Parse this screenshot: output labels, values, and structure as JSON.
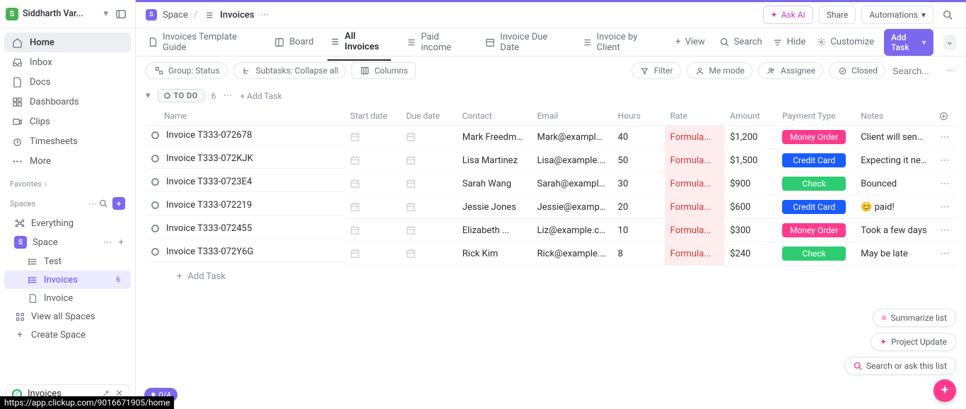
{
  "workspace": {
    "badge": "S",
    "name": "Siddharth Var..."
  },
  "nav": {
    "items": [
      {
        "label": "Home"
      },
      {
        "label": "Inbox"
      },
      {
        "label": "Docs"
      },
      {
        "label": "Dashboards"
      },
      {
        "label": "Clips"
      },
      {
        "label": "Timesheets"
      },
      {
        "label": "More"
      }
    ]
  },
  "favorites_label": "Favorites",
  "spaces_label": "Spaces",
  "spaces": {
    "everything": "Everything",
    "space_badge": "S",
    "space_name": "Space",
    "test": "Test",
    "invoices": "Invoices",
    "invoices_count": "6",
    "invoice_single": "Invoice",
    "view_all": "View all Spaces",
    "create": "Create Space"
  },
  "footer": {
    "label": "Invoices"
  },
  "breadcrumb": {
    "space": "Space",
    "list": "Invoices"
  },
  "topbar": {
    "ask_ai": "Ask AI",
    "share": "Share",
    "automations": "Automations"
  },
  "views": {
    "guide": "Invoices Template Guide",
    "board": "Board",
    "all": "All Invoices",
    "paid": "Paid income",
    "due": "Invoice Due Date",
    "by_client": "Invoice by Client",
    "view": "View",
    "search": "Search",
    "hide": "Hide",
    "customize": "Customize",
    "add_task": "Add Task"
  },
  "filters": {
    "group": "Group: Status",
    "subtasks": "Subtasks: Collapse all",
    "columns": "Columns",
    "filter": "Filter",
    "me": "Me mode",
    "assignee": "Assignee",
    "closed": "Closed",
    "search_ph": "Search..."
  },
  "group": {
    "status": "TO DO",
    "count": "6",
    "add": "Add Task"
  },
  "columns": {
    "name": "Name",
    "start": "Start date",
    "due": "Due date",
    "contact": "Contact",
    "email": "Email",
    "hours": "Hours",
    "rate": "Rate",
    "amount": "Amount",
    "payment": "Payment Type",
    "notes": "Notes"
  },
  "rate_text": "Formula...",
  "rows": [
    {
      "name": "Invoice T333-072678",
      "contact": "Mark Freedman",
      "email": "Mark@example.c...",
      "hours": "40",
      "amount": "$1,200",
      "pay": "Money Order",
      "pay_cls": "money",
      "notes": "Client will send ..."
    },
    {
      "name": "Invoice T333-072KJK",
      "contact": "Lisa Martinez",
      "email": "Lisa@example.com",
      "hours": "50",
      "amount": "$1,500",
      "pay": "Credit Card",
      "pay_cls": "credit",
      "notes": "Expecting it next..."
    },
    {
      "name": "Invoice T333-0723E4",
      "contact": "Sarah Wang",
      "email": "Sarah@example.c...",
      "hours": "30",
      "amount": "$900",
      "pay": "Check",
      "pay_cls": "check",
      "notes": "Bounced"
    },
    {
      "name": "Invoice T333-072219",
      "contact": "Jessie Jones",
      "email": "Jessie@example.c...",
      "hours": "20",
      "amount": "$600",
      "pay": "Credit Card",
      "pay_cls": "credit",
      "notes": "😊 paid!"
    },
    {
      "name": "Invoice T333-072455",
      "contact": "Elizabeth ...",
      "email": "Liz@example.com",
      "hours": "10",
      "amount": "$300",
      "pay": "Money Order",
      "pay_cls": "money",
      "notes": "Took a few days"
    },
    {
      "name": "Invoice T333-072Y6G",
      "contact": "Rick Kim",
      "email": "Rick@example.com",
      "hours": "8",
      "amount": "$240",
      "pay": "Check",
      "pay_cls": "check",
      "notes": "May be late"
    }
  ],
  "add_row": "Add Task",
  "float": {
    "summarize": "Summarize list",
    "update": "Project Update",
    "search": "Search or ask this list"
  },
  "rec": "0/4",
  "url": "https://app.clickup.com/9016671905/home"
}
